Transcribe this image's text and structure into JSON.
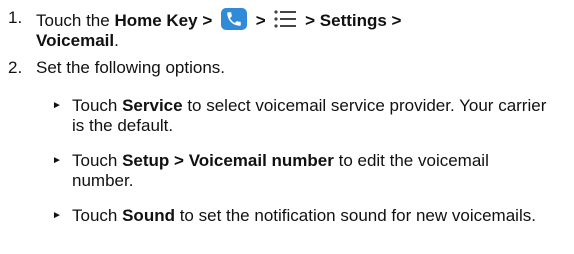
{
  "steps": [
    {
      "num": "1.",
      "parts": {
        "touch": "Touch the ",
        "home_key": "Home Key >",
        "sep1": ">",
        "sep2": "> Settings >",
        "voicemail": "Voicemail",
        "period": "."
      },
      "icons": [
        "phone-icon",
        "menu-icon"
      ]
    },
    {
      "num": "2.",
      "text": "Set the following options."
    }
  ],
  "bullets": [
    {
      "marker": "►",
      "pre": "Touch ",
      "bold": "Service",
      "post": " to select voicemail service provider. Your carrier is the default."
    },
    {
      "marker": "►",
      "pre": "Touch ",
      "bold": "Setup > Voicemail number",
      "post": " to edit the voicemail number."
    },
    {
      "marker": "►",
      "pre": "Touch ",
      "bold": "Sound",
      "post": " to set the notification sound for new voicemails."
    }
  ],
  "colors": {
    "phone_icon_bg": "#2f8bd8",
    "text": "#111111"
  }
}
